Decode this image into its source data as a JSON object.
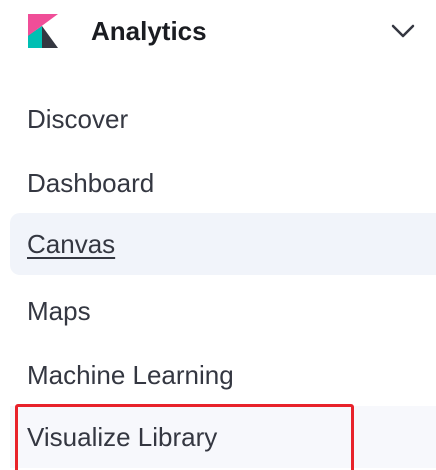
{
  "group": {
    "title": "Analytics",
    "logo_icon": "kibana-logo-icon",
    "toggle_icon": "chevron-down-icon"
  },
  "items": [
    {
      "label": "Discover"
    },
    {
      "label": "Dashboard"
    },
    {
      "label": "Canvas"
    },
    {
      "label": "Maps"
    },
    {
      "label": "Machine Learning"
    },
    {
      "label": "Visualize Library"
    }
  ],
  "colors": {
    "logo_pink": "#f04e98",
    "logo_teal": "#00bfb3",
    "logo_dark": "#343741",
    "highlight": "#e8222a",
    "active_bg": "#f1f4fa"
  }
}
